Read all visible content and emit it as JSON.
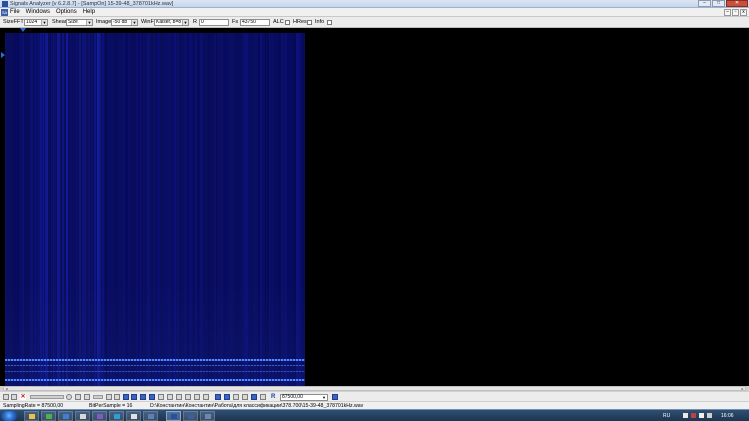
{
  "window": {
    "title": "Signals Analyzer [v 6.2.8.7] - [SampOn] 15-39-48_378701kHz.wav]",
    "controls": {
      "minimize": "–",
      "maximize": "□",
      "close": "✕"
    }
  },
  "menu": {
    "icon_text": "SA",
    "items": [
      "File",
      "Windows",
      "Options",
      "Help"
    ],
    "mdi_controls": [
      "–",
      "▫",
      "x"
    ]
  },
  "toolbar": {
    "sizefft_label": "SizeFFT",
    "sizefft_value": "1024",
    "shear_label": "Shear",
    "shear_value": "Size",
    "image_label": "Image",
    "image_value": "-50 db",
    "winf_label": "WinF",
    "winf_value": "Kaiser, b=8",
    "r_label": "R",
    "r_value": "0",
    "fs_label": "Fs",
    "fs_value": "43750",
    "alc_label": "ALC",
    "hres_label": "HRes",
    "info_label": "Info"
  },
  "spectrogram": {
    "icon_colors": {
      "background": "#0a0e55",
      "marker": "#2f6bd8",
      "stripe": "#4f8cff"
    }
  },
  "bottom_toolbar": {
    "r_label": "R",
    "frequency_value": "87500,00",
    "icons": [
      "back-icon",
      "forward-icon",
      "stop-icon",
      "zoom-icon",
      "grid-icon",
      "play-icon",
      "filter-icon",
      "save-icon",
      "settings-icon"
    ]
  },
  "status": {
    "sampling_rate": "SamplingRate = 87500,00",
    "bits_per_sample": "BitPerSample = 16",
    "file_path": "D:\\Константин\\Константин\\Работа\\для классификации\\378.700\\15-39-48_378701kHz.wav"
  },
  "taskbar": {
    "language": "RU",
    "clock": "16:06"
  }
}
